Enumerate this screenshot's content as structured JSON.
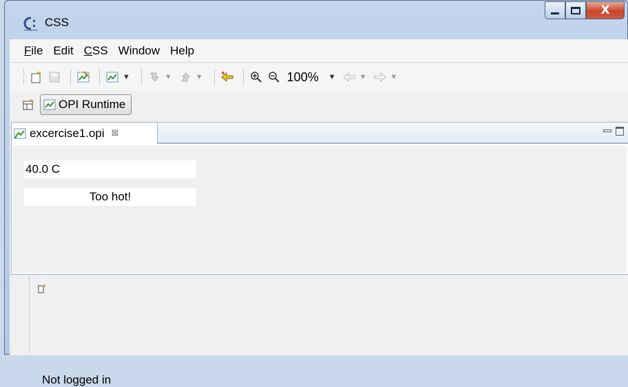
{
  "window": {
    "title": "CSS"
  },
  "menubar": {
    "items": [
      {
        "label": "File",
        "mnemonic": "F",
        "rest": "ile"
      },
      {
        "label": "Edit",
        "mnemonic": "",
        "rest": "Edit"
      },
      {
        "label": "CSS",
        "mnemonic": "C",
        "rest": "SS"
      },
      {
        "label": "Window",
        "mnemonic": "",
        "rest": "Window"
      },
      {
        "label": "Help",
        "mnemonic": "",
        "rest": "Help"
      }
    ]
  },
  "toolbar": {
    "zoom": "100%"
  },
  "perspective": {
    "label": "OPI Runtime"
  },
  "editor": {
    "tab_label": "excercise1.opi",
    "close_glyph": "⊠",
    "text_update_1": "40.0 C",
    "text_update_2": "Too hot!"
  },
  "status": {
    "text": "Not logged in"
  },
  "colors": {
    "titlebar": "#b9cde8",
    "close_button": "#c8452c",
    "editor_border": "#9db0c9"
  }
}
